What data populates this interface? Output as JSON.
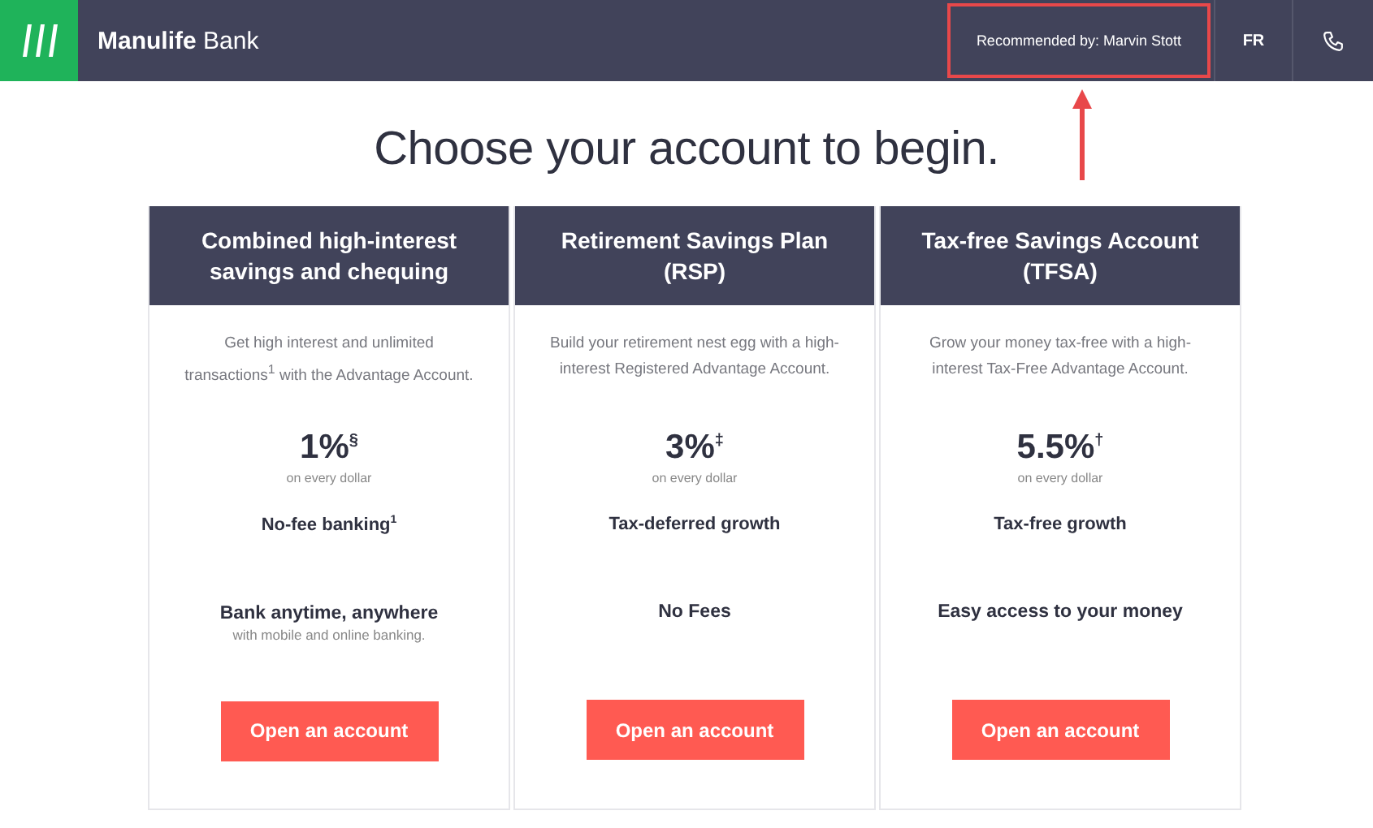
{
  "header": {
    "brand": "**Manulife** Bank",
    "recommended": {
      "text": "Recommended by: Marvin Stott",
      "highlighted": true
    },
    "language": "FR"
  },
  "title": "Choose your account to begin.",
  "cards": [
    {
      "heading": "Combined high-interest savings and chequing",
      "description": "Get high interest and unlimited transactions$^{1}$ with the Advantage Account.",
      "rate": "1%$^{§}$",
      "rate_note": "on every dollar",
      "feature": "No-fee banking$^{1}$",
      "highlight": "Bank anytime, anywhere",
      "highlight_note": "with mobile and online banking.",
      "button": "Open an account"
    },
    {
      "heading": "Retirement Savings Plan (RSP)",
      "description": "Build your retirement nest egg with a high-interest Registered Advantage Account.",
      "rate": "3%$^{‡}$",
      "rate_note": "on every dollar",
      "feature": "Tax-deferred growth",
      "highlight": "No Fees",
      "button": "Open an account"
    },
    {
      "heading": "Tax-free Savings Account (TFSA)",
      "description": "Grow your money tax-free with a high-interest Tax-Free Advantage Account.",
      "rate": "5.5%$^{†}$",
      "rate_note": "on every dollar",
      "feature": "Tax-free growth",
      "highlight": "Easy access to your money",
      "button": "Open an account"
    }
  ]
}
